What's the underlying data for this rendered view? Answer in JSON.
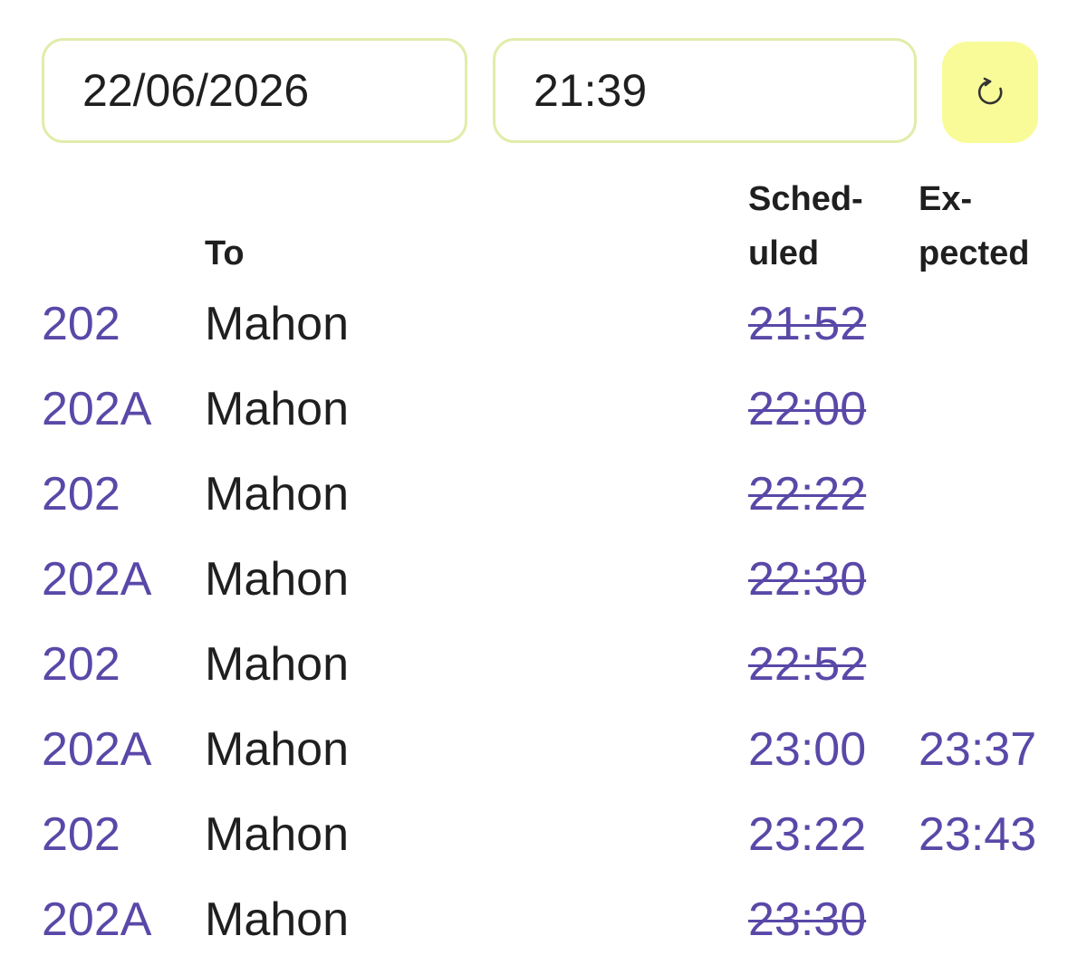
{
  "query": {
    "date_value": "22/06/2026",
    "time_value": "21:39",
    "refresh_icon": "refresh-icon"
  },
  "headers": {
    "to": "To",
    "scheduled_line1": "Sched-",
    "scheduled_line2": "uled",
    "expected_line1": "Ex-",
    "expected_line2": "pected"
  },
  "departures": [
    {
      "route": "202",
      "destination": "Mahon",
      "scheduled": "21:52",
      "cancelled": true,
      "expected": ""
    },
    {
      "route": "202A",
      "destination": "Mahon",
      "scheduled": "22:00",
      "cancelled": true,
      "expected": ""
    },
    {
      "route": "202",
      "destination": "Mahon",
      "scheduled": "22:22",
      "cancelled": true,
      "expected": ""
    },
    {
      "route": "202A",
      "destination": "Mahon",
      "scheduled": "22:30",
      "cancelled": true,
      "expected": ""
    },
    {
      "route": "202",
      "destination": "Mahon",
      "scheduled": "22:52",
      "cancelled": true,
      "expected": ""
    },
    {
      "route": "202A",
      "destination": "Mahon",
      "scheduled": "23:00",
      "cancelled": false,
      "expected": "23:37"
    },
    {
      "route": "202",
      "destination": "Mahon",
      "scheduled": "23:22",
      "cancelled": false,
      "expected": "23:43"
    },
    {
      "route": "202A",
      "destination": "Mahon",
      "scheduled": "23:30",
      "cancelled": true,
      "expected": ""
    }
  ],
  "colors": {
    "accent": "#5a48a8",
    "input_border": "#e2ecaa",
    "refresh_bg": "#f9fb98",
    "text": "#1f1f1f"
  }
}
